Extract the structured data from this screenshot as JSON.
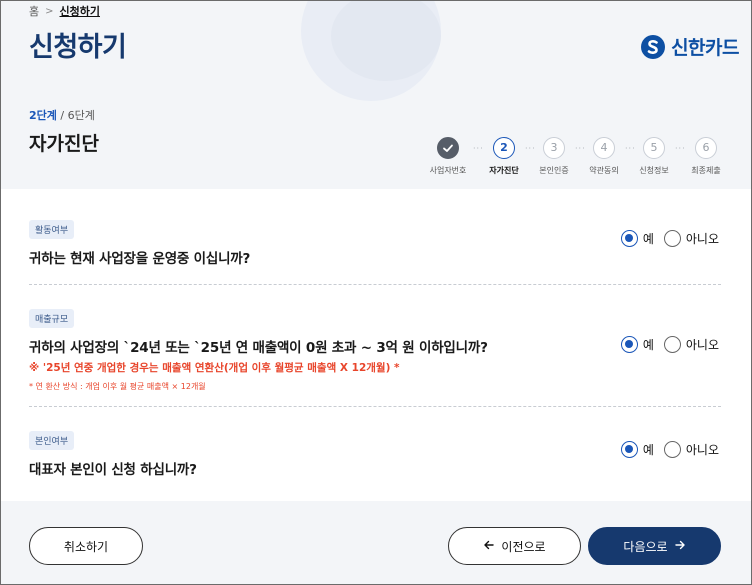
{
  "breadcrumb": {
    "home": "홈",
    "current": "신청하기"
  },
  "page_title": "신청하기",
  "brand": {
    "name": "신한카드",
    "color": "#0d4fa3"
  },
  "progress": {
    "current_step": "2단계",
    "separator": "/",
    "total_steps": "6단계"
  },
  "section_title": "자가진단",
  "steps": [
    {
      "number": "",
      "label": "사업자번호",
      "state": "done"
    },
    {
      "number": "2",
      "label": "자가진단",
      "state": "active"
    },
    {
      "number": "3",
      "label": "본인인증",
      "state": "pending"
    },
    {
      "number": "4",
      "label": "약관동의",
      "state": "pending"
    },
    {
      "number": "5",
      "label": "신청정보",
      "state": "pending"
    },
    {
      "number": "6",
      "label": "최종제출",
      "state": "pending"
    }
  ],
  "questions": [
    {
      "tag": "활동여부",
      "text": "귀하는 현재 사업장을 운영중 이십니까?",
      "options": {
        "yes": "예",
        "no": "아니오"
      },
      "selected": "yes"
    },
    {
      "tag": "매출규모",
      "text": "귀하의 사업장의 `24년 또는 `25년 연 매출액이 0원 초과 ~ 3억 원 이하입니까?",
      "note": "※ '25년 연중 개업한 경우는 매출액 연환산(개업 이후 월평균 매출액 X 12개월) *",
      "note_small": "* 연 환산 방식 : 개업 이후 월 평균 매출액 × 12개월",
      "options": {
        "yes": "예",
        "no": "아니오"
      },
      "selected": "yes"
    },
    {
      "tag": "본인여부",
      "text": "대표자 본인이 신청 하십니까?",
      "options": {
        "yes": "예",
        "no": "아니오"
      },
      "selected": "yes"
    }
  ],
  "buttons": {
    "cancel": "취소하기",
    "prev": "이전으로",
    "next": "다음으로"
  },
  "colors": {
    "primary": "#16396e",
    "accent": "#1a56b8",
    "warning": "#e8452b"
  }
}
